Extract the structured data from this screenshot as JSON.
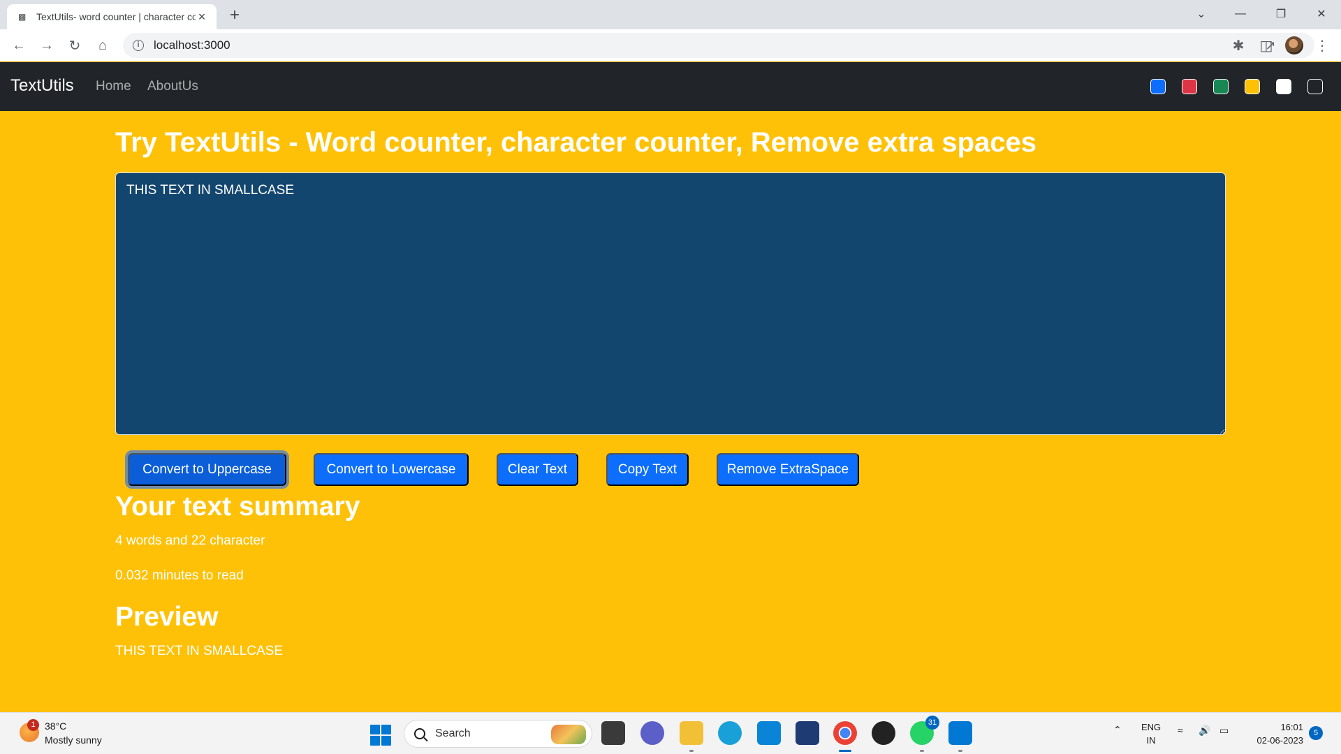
{
  "browser": {
    "tab_title": "TextUtils- word counter | character counter",
    "url": "localhost:3000"
  },
  "navbar": {
    "brand": "TextUtils",
    "links": [
      "Home",
      "AboutUs"
    ],
    "theme_swatches": [
      "#0d6efd",
      "#dc3545",
      "#198754",
      "#ffc107",
      "#ffffff",
      "#212529"
    ]
  },
  "main": {
    "heading": "Try TextUtils - Word counter, character counter, Remove extra spaces",
    "textarea_value": "THIS TEXT IN SMALLCASE",
    "buttons": [
      "Convert to Uppercase",
      "Convert to Lowercase",
      "Clear Text",
      "Copy Text",
      "Remove ExtraSpace"
    ],
    "summary_heading": "Your text summary",
    "word_char_count": "4 words and 22 character",
    "read_time": "0.032 minutes to read",
    "preview_heading": "Preview",
    "preview_text": "THIS TEXT IN SMALLCASE"
  },
  "colors": {
    "page_background": "#ffc107",
    "textarea_background": "#13466e",
    "button": "#0d6efd",
    "navbar": "#212529"
  },
  "taskbar": {
    "weather_temp": "38°C",
    "weather_desc": "Mostly sunny",
    "weather_badge": "1",
    "search_placeholder": "Search",
    "whatsapp_badge": "31",
    "lang_line1": "ENG",
    "lang_line2": "IN",
    "time": "16:01",
    "date": "02-06-2023",
    "notification_count": "5"
  }
}
